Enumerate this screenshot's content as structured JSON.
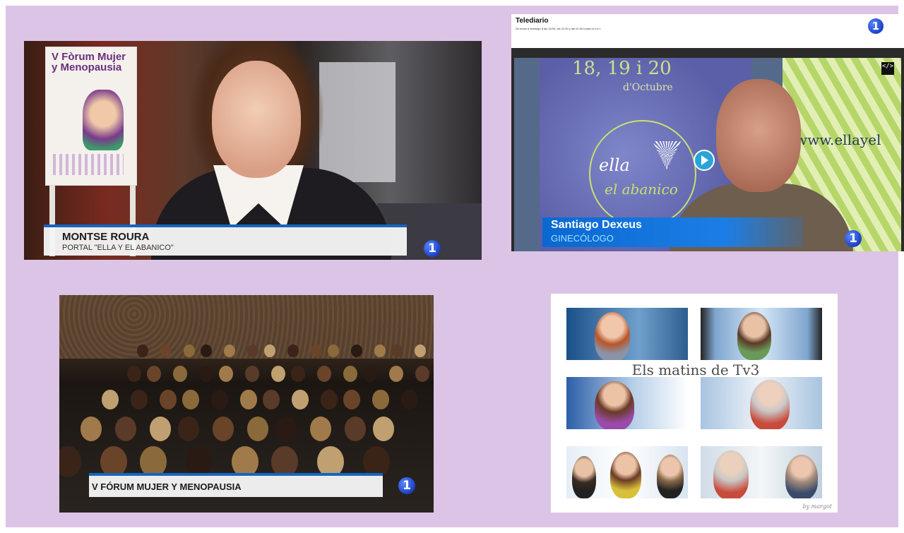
{
  "panel1": {
    "name": "MONTSE ROURA",
    "role": "PORTAL \"ELLA Y EL ABANICO\"",
    "poster_title": "V Fòrum Mujer y Menopausia",
    "channel_logo": "1"
  },
  "panel2": {
    "header_title": "Telediario",
    "header_subtitle": "De lunes a domingo a las 15:00, las 21:00 y las 01:00 horas en La 1",
    "banner_dates": "18, 19 i 20",
    "banner_month": "d'Octubre",
    "banner_ella": "ella",
    "banner_abanico": "el abanico",
    "banner_web": "www.ellayel",
    "name": "Santiago Dexeus",
    "role": "GINECÓLOGO",
    "channel_logo": "1",
    "embed_icon": "</>"
  },
  "panel3": {
    "caption": "V FÓRUM MUJER Y MENOPAUSIA",
    "channel_logo": "1"
  },
  "panel4": {
    "title": "Els matins de Tv3",
    "signature": "by margot"
  },
  "colors": {
    "background": "#dcc4e6",
    "tve_blue": "#1565c0"
  }
}
